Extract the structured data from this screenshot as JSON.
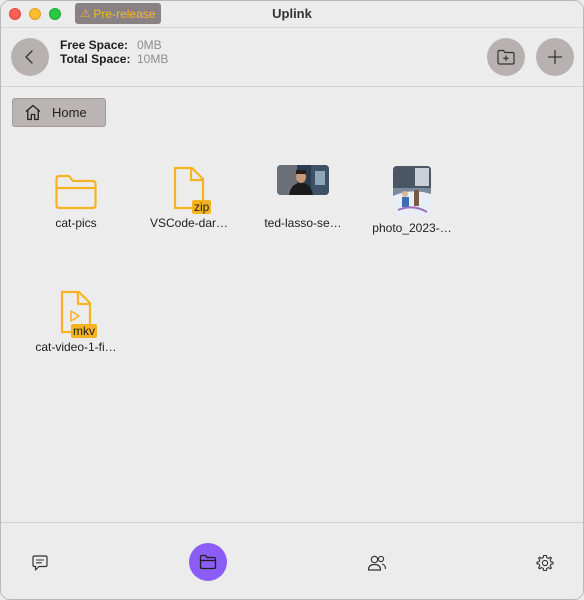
{
  "window": {
    "title": "Uplink",
    "badge": "Pre-release",
    "badge_icon": "warning-triangle-icon"
  },
  "toolbar": {
    "free_space_label": "Free Space:",
    "free_space_value": "0MB",
    "total_space_label": "Total Space:",
    "total_space_value": "10MB",
    "buttons": [
      "back-icon",
      "new-folder-icon",
      "plus-icon"
    ]
  },
  "breadcrumb": {
    "label": "Home",
    "icon": "home-icon"
  },
  "files": [
    {
      "name": "cat-pics",
      "type": "folder"
    },
    {
      "name": "VSCode-dar…",
      "type": "file",
      "ext": "zip"
    },
    {
      "name": "ted-lasso-se…",
      "type": "image"
    },
    {
      "name": "photo_2023-…",
      "type": "image"
    },
    {
      "name": "cat-video-1-fi…",
      "type": "video",
      "ext": "mkv"
    }
  ],
  "footer": {
    "items": [
      "chat-icon",
      "files-icon",
      "friends-icon",
      "settings-icon"
    ],
    "active": "files-icon"
  },
  "colors": {
    "accent": "#8b5cf6",
    "file_icon": "#f5b321",
    "button": "#b8b1b1",
    "background": "#ececec"
  }
}
